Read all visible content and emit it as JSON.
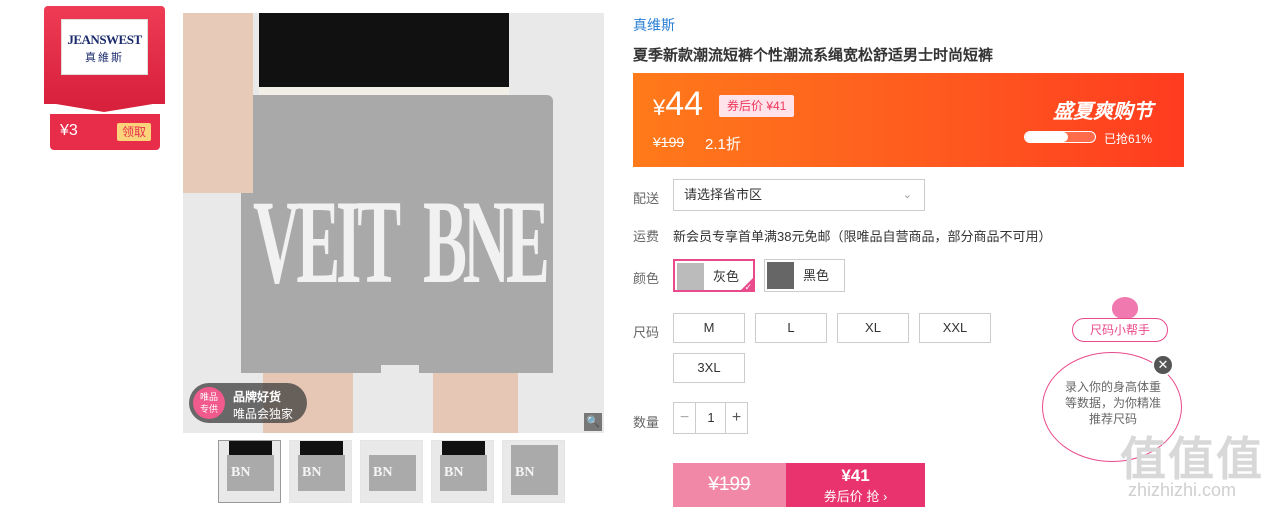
{
  "brand_card": {
    "logo_line1": "JEANSWEST",
    "logo_line2": "真維斯",
    "coupon_value": "¥3",
    "claim_label": "领取"
  },
  "gallery": {
    "print_left": "VEIT",
    "print_right": "BNE",
    "badge_circle": "唯品\n专供",
    "badge_title": "品牌好货",
    "badge_subtitle": "唯品会独家",
    "zoom_icon": "magnifier-icon",
    "thumbnails": [
      "BN",
      "BN",
      "BN",
      "BN",
      "BN"
    ]
  },
  "product": {
    "store_name": "真维斯",
    "title": "夏季新款潮流短裤个性潮流系绳宽松舒适男士时尚短裤"
  },
  "promo": {
    "currency": "¥",
    "price": "44",
    "coupon_tag": "券后价 ¥41",
    "original_price": "¥199",
    "discount": "2.1折",
    "event_title": "盛夏爽购节",
    "progress_fraction": 0.61,
    "progress_text": "已抢61%",
    "colors": {
      "start": "#ff7a1a",
      "end": "#ff3b1f"
    }
  },
  "delivery": {
    "label": "配送",
    "region_placeholder": "请选择省市区"
  },
  "shipping": {
    "label": "运费",
    "text": "新会员专享首单满38元免邮（限唯品自营商品，部分商品不可用）"
  },
  "color": {
    "label": "颜色",
    "options": [
      {
        "label": "灰色",
        "selected": true
      },
      {
        "label": "黑色",
        "selected": false
      }
    ]
  },
  "size": {
    "label": "尺码",
    "options": [
      "M",
      "L",
      "XL",
      "XXL",
      "3XL"
    ]
  },
  "quantity": {
    "label": "数量",
    "minus": "−",
    "value": "1",
    "plus": "+"
  },
  "buy": {
    "original_price": "¥199",
    "coupon_price": "¥41",
    "action_label": "券后价 抢 ›",
    "accent": "#e8336e"
  },
  "helper": {
    "title": "尺码小帮手",
    "text": "录入你的身高体重等数据，为你精准推荐尺码",
    "close_icon": "close-icon"
  },
  "watermark": {
    "mark": "值值值",
    "url": "zhizhizhi.com"
  }
}
